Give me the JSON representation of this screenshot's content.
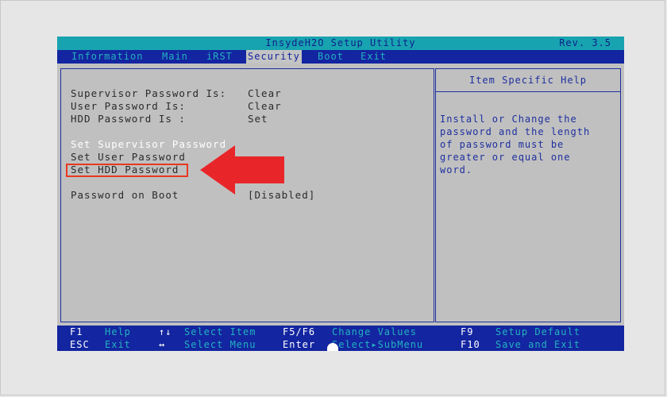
{
  "title": "InsydeH2O Setup Utility",
  "revision": "Rev. 3.5",
  "menu": [
    {
      "label": "Information",
      "active": false
    },
    {
      "label": "Main",
      "active": false
    },
    {
      "label": "iRST",
      "active": false
    },
    {
      "label": "Security",
      "active": true
    },
    {
      "label": "Boot",
      "active": false
    },
    {
      "label": "Exit",
      "active": false
    }
  ],
  "status": {
    "supervisor_label": "Supervisor Password Is:",
    "supervisor_value": "Clear",
    "user_label": "User Password Is:",
    "user_value": "Clear",
    "hdd_label": "HDD Password Is :",
    "hdd_value": "Set"
  },
  "actions": {
    "set_supervisor": "Set Supervisor Password",
    "set_user": "Set User Password",
    "set_hdd": "Set HDD Password"
  },
  "boot_password": {
    "label": "Password on Boot",
    "value": "[Disabled]"
  },
  "help": {
    "header": "Item Specific Help",
    "lines": [
      "Install or Change the",
      "password and the length",
      "of password  must be",
      "greater or equal one",
      "word."
    ]
  },
  "footer": {
    "row1": [
      {
        "key": "F1",
        "desc": "Help"
      },
      {
        "key": "↑↓",
        "desc": "Select Item"
      },
      {
        "key": "F5/F6",
        "desc": "Change Values"
      },
      {
        "key": "F9",
        "desc": "Setup Default"
      }
    ],
    "row2": [
      {
        "key": "ESC",
        "desc": "Exit"
      },
      {
        "key": "↔",
        "desc": "Select Menu"
      },
      {
        "key": "Enter",
        "desc": "Select▸SubMenu"
      },
      {
        "key": "F10",
        "desc": "Save and Exit"
      }
    ]
  },
  "colors": {
    "title_bar": "#18a3b0",
    "menu_bar": "#1325a0",
    "panel_bg": "#c0c0c0",
    "highlight_box": "#e8381f",
    "arrow": "#e8262a"
  }
}
